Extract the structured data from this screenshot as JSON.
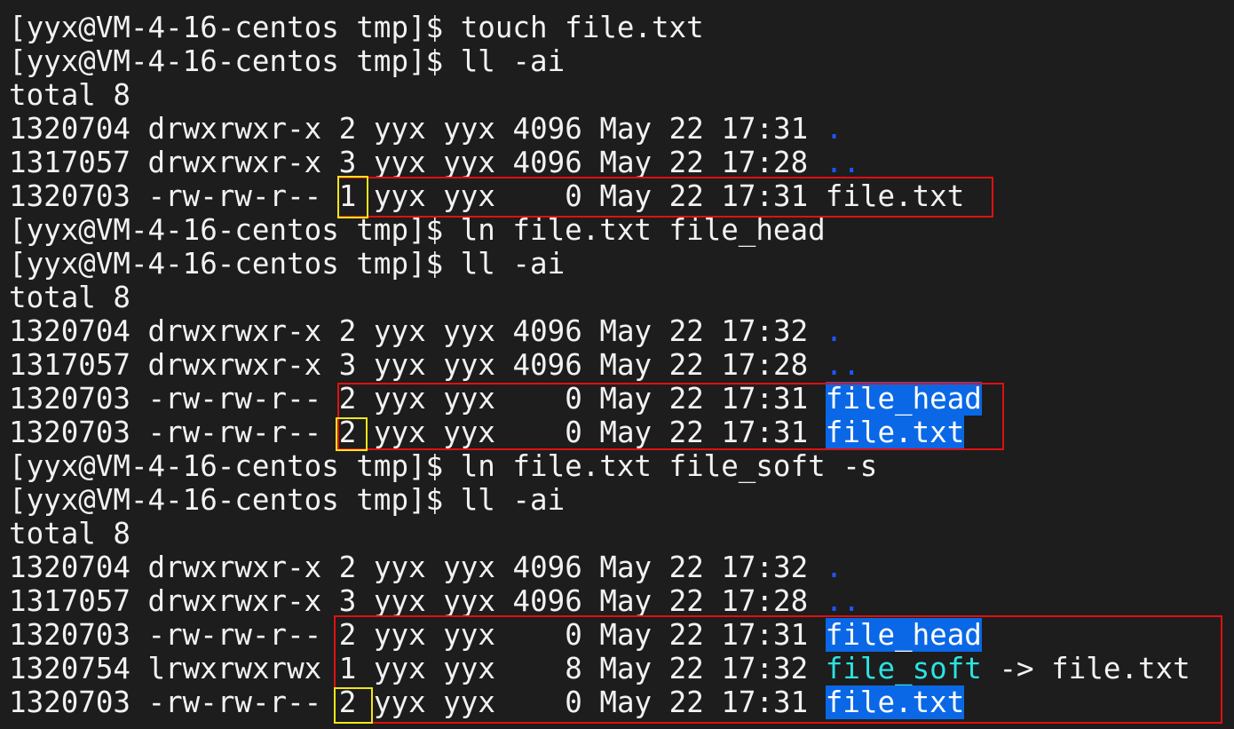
{
  "terminal": {
    "prompt": "[yyx@VM-4-16-centos tmp]$ ",
    "lines": [
      {
        "type": "cmd",
        "text": "touch file.txt"
      },
      {
        "type": "cmd",
        "text": "ll -ai"
      },
      {
        "type": "text",
        "text": "total 8"
      },
      {
        "type": "entry",
        "inode": "1320704",
        "perm": "drwxrwxr-x",
        "links": "2",
        "owner": "yyx",
        "group": "yyx",
        "size": "4096",
        "date": "May 22 17:31",
        "name": ".",
        "style": "dir"
      },
      {
        "type": "entry",
        "inode": "1317057",
        "perm": "drwxrwxr-x",
        "links": "3",
        "owner": "yyx",
        "group": "yyx",
        "size": "4096",
        "date": "May 22 17:28",
        "name": "..",
        "style": "dir"
      },
      {
        "type": "entry",
        "inode": "1320703",
        "perm": "-rw-rw-r--",
        "links": "1",
        "owner": "yyx",
        "group": "yyx",
        "size": "0",
        "date": "May 22 17:31",
        "name": "file.txt",
        "style": "plain"
      },
      {
        "type": "cmd",
        "text": "ln file.txt file_head"
      },
      {
        "type": "cmd",
        "text": "ll -ai"
      },
      {
        "type": "text",
        "text": "total 8"
      },
      {
        "type": "entry",
        "inode": "1320704",
        "perm": "drwxrwxr-x",
        "links": "2",
        "owner": "yyx",
        "group": "yyx",
        "size": "4096",
        "date": "May 22 17:32",
        "name": ".",
        "style": "dir"
      },
      {
        "type": "entry",
        "inode": "1317057",
        "perm": "drwxrwxr-x",
        "links": "3",
        "owner": "yyx",
        "group": "yyx",
        "size": "4096",
        "date": "May 22 17:28",
        "name": "..",
        "style": "dir"
      },
      {
        "type": "entry",
        "inode": "1320703",
        "perm": "-rw-rw-r--",
        "links": "2",
        "owner": "yyx",
        "group": "yyx",
        "size": "0",
        "date": "May 22 17:31",
        "name": "file_head",
        "style": "hl"
      },
      {
        "type": "entry",
        "inode": "1320703",
        "perm": "-rw-rw-r--",
        "links": "2",
        "owner": "yyx",
        "group": "yyx",
        "size": "0",
        "date": "May 22 17:31",
        "name": "file.txt",
        "style": "hl"
      },
      {
        "type": "cmd",
        "text": "ln file.txt file_soft -s"
      },
      {
        "type": "cmd",
        "text": "ll -ai"
      },
      {
        "type": "text",
        "text": "total 8"
      },
      {
        "type": "entry",
        "inode": "1320704",
        "perm": "drwxrwxr-x",
        "links": "2",
        "owner": "yyx",
        "group": "yyx",
        "size": "4096",
        "date": "May 22 17:32",
        "name": ".",
        "style": "dir"
      },
      {
        "type": "entry",
        "inode": "1317057",
        "perm": "drwxrwxr-x",
        "links": "3",
        "owner": "yyx",
        "group": "yyx",
        "size": "4096",
        "date": "May 22 17:28",
        "name": "..",
        "style": "dir"
      },
      {
        "type": "entry",
        "inode": "1320703",
        "perm": "-rw-rw-r--",
        "links": "2",
        "owner": "yyx",
        "group": "yyx",
        "size": "0",
        "date": "May 22 17:31",
        "name": "file_head",
        "style": "hl"
      },
      {
        "type": "entry",
        "inode": "1320754",
        "perm": "lrwxrwxrwx",
        "links": "1",
        "owner": "yyx",
        "group": "yyx",
        "size": "8",
        "date": "May 22 17:32",
        "name": "file_soft",
        "style": "link",
        "target": "file.txt"
      },
      {
        "type": "entry",
        "inode": "1320703",
        "perm": "-rw-rw-r--",
        "links": "2",
        "owner": "yyx",
        "group": "yyx",
        "size": "0",
        "date": "May 22 17:31",
        "name": "file.txt",
        "style": "hl"
      }
    ]
  },
  "colors": {
    "background": "#1d1d1d",
    "text": "#f2f2f2",
    "directory": "#1f55ff",
    "highlight_bg": "#0a68e6",
    "symlink": "#2ce2e2",
    "annotation_red": "#e01010",
    "annotation_yellow": "#f2e51a"
  }
}
